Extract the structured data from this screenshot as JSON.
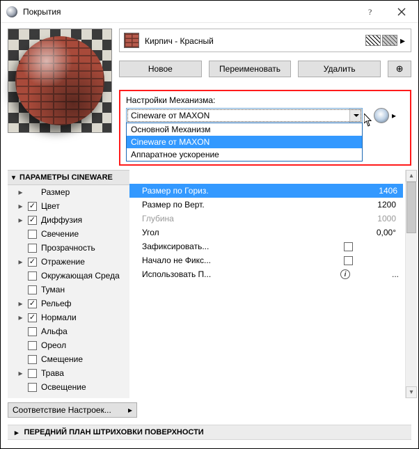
{
  "titlebar": {
    "title": "Покрытия"
  },
  "material": {
    "name": "Кирпич - Красный"
  },
  "buttons": {
    "new": "Новое",
    "rename": "Переименовать",
    "delete": "Удалить"
  },
  "engine": {
    "label": "Настройки Механизма:",
    "selected": "Cineware от MAXON",
    "options": [
      "Основной Механизм",
      "Cineware от MAXON",
      "Аппаратное ускорение"
    ]
  },
  "sidebar": {
    "header": "ПАРАМЕТРЫ CINEWARE",
    "items": [
      {
        "label": "Размер",
        "checked": false,
        "expandable": true,
        "hasCheckbox": false
      },
      {
        "label": "Цвет",
        "checked": true,
        "expandable": true,
        "hasCheckbox": true
      },
      {
        "label": "Диффузия",
        "checked": true,
        "expandable": true,
        "hasCheckbox": true
      },
      {
        "label": "Свечение",
        "checked": false,
        "expandable": false,
        "hasCheckbox": true
      },
      {
        "label": "Прозрачность",
        "checked": false,
        "expandable": false,
        "hasCheckbox": true
      },
      {
        "label": "Отражение",
        "checked": true,
        "expandable": true,
        "hasCheckbox": true
      },
      {
        "label": "Окружающая Среда",
        "checked": false,
        "expandable": false,
        "hasCheckbox": true
      },
      {
        "label": "Туман",
        "checked": false,
        "expandable": false,
        "hasCheckbox": true
      },
      {
        "label": "Рельеф",
        "checked": true,
        "expandable": true,
        "hasCheckbox": true
      },
      {
        "label": "Нормали",
        "checked": true,
        "expandable": true,
        "hasCheckbox": true
      },
      {
        "label": "Альфа",
        "checked": false,
        "expandable": false,
        "hasCheckbox": true
      },
      {
        "label": "Ореол",
        "checked": false,
        "expandable": false,
        "hasCheckbox": true
      },
      {
        "label": "Смещение",
        "checked": false,
        "expandable": false,
        "hasCheckbox": true
      },
      {
        "label": "Трава",
        "checked": false,
        "expandable": true,
        "hasCheckbox": true
      },
      {
        "label": "Освещение",
        "checked": false,
        "expandable": false,
        "hasCheckbox": true
      }
    ]
  },
  "props": {
    "size_h_label": "Размер по Гориз.",
    "size_h_value": "1406",
    "size_v_label": "Размер по Верт.",
    "size_v_value": "1200",
    "depth_label": "Глубина",
    "depth_value": "1000",
    "angle_label": "Угол",
    "angle_value": "0,00°",
    "lock_label": "Зафиксировать...",
    "origin_label": "Начало не Фикс...",
    "use_label": "Использовать П..."
  },
  "match_btn": "Соответствие Настроек...",
  "fg_section": "ПЕРЕДНИЙ ПЛАН ШТРИХОВКИ ПОВЕРХНОСТИ"
}
